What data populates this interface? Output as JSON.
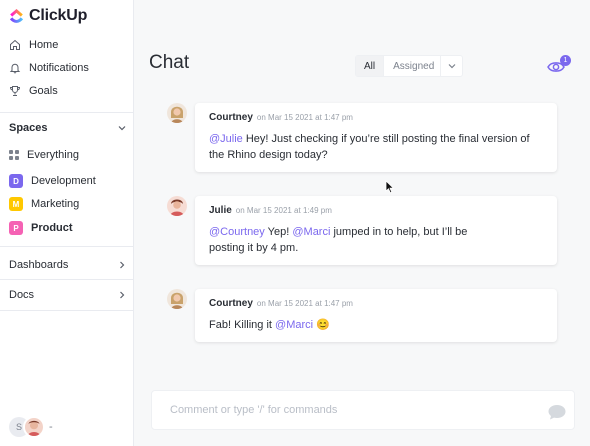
{
  "app": {
    "name": "ClickUp"
  },
  "sidebar": {
    "nav": [
      {
        "label": "Home",
        "icon": "home-icon"
      },
      {
        "label": "Notifications",
        "icon": "bell-icon"
      },
      {
        "label": "Goals",
        "icon": "trophy-icon"
      }
    ],
    "spaces_label": "Spaces",
    "everything_label": "Everything",
    "spaces": [
      {
        "letter": "D",
        "label": "Development",
        "color": "#7b68ee"
      },
      {
        "letter": "M",
        "label": "Marketing",
        "color": "#ffc800"
      },
      {
        "letter": "P",
        "label": "Product",
        "color": "#f562b4"
      }
    ],
    "dashboards_label": "Dashboards",
    "docs_label": "Docs",
    "user_initial": "S",
    "user_dash": "-"
  },
  "main": {
    "title": "Chat",
    "filter": {
      "all": "All",
      "assigned": "Assigned"
    },
    "watchers_count": "1",
    "messages": [
      {
        "author": "Courtney",
        "time": "on Mar 15 2021 at 1:47 pm",
        "mention": "@Julie",
        "text": " Hey! Just checking if you’re still posting the final version of the Rhino design today?",
        "mention2": "",
        "text2": ""
      },
      {
        "author": "Julie",
        "time": "on Mar 15 2021 at 1:49 pm",
        "mention": "@Courtney",
        "text": " Yep! ",
        "mention2": "@Marci",
        "text2": " jumped in to help, but I’ll be posting it by 4 pm."
      },
      {
        "author": "Courtney",
        "time": "on Mar 15 2021 at 1:47 pm",
        "text": "Fab! Killing it ",
        "mention": "@Marci",
        "emoji": "😊"
      }
    ],
    "composer_placeholder": "Comment or type '/' for commands"
  },
  "colors": {
    "accent": "#7b68ee"
  }
}
